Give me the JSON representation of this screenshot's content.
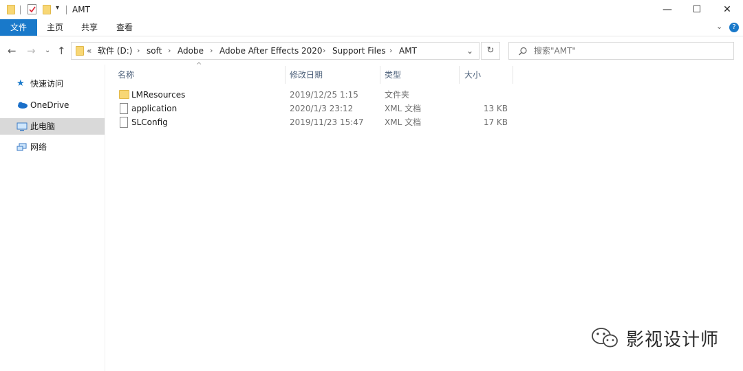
{
  "window": {
    "title": "AMT"
  },
  "ribbon": {
    "tabs": [
      "文件",
      "主页",
      "共享",
      "查看"
    ]
  },
  "address": {
    "overflow": "«",
    "crumbs": [
      "软件 (D:)",
      "soft",
      "Adobe",
      "Adobe After Effects 2020",
      "Support Files",
      "AMT"
    ]
  },
  "search": {
    "placeholder": "搜索\"AMT\""
  },
  "nav": {
    "items": [
      "快速访问",
      "OneDrive",
      "此电脑",
      "网络"
    ]
  },
  "columns": {
    "name": "名称",
    "date": "修改日期",
    "type": "类型",
    "size": "大小"
  },
  "files": [
    {
      "name": "LMResources",
      "date": "2019/12/25 1:15",
      "type": "文件夹",
      "size": "",
      "kind": "folder"
    },
    {
      "name": "application",
      "date": "2020/1/3 23:12",
      "type": "XML 文档",
      "size": "13 KB",
      "kind": "file"
    },
    {
      "name": "SLConfig",
      "date": "2019/11/23 15:47",
      "type": "XML 文档",
      "size": "17 KB",
      "kind": "file"
    }
  ],
  "watermark": {
    "text": "影视设计师"
  },
  "colors": {
    "accent": "#1979ca",
    "folder": "#f8d775"
  }
}
